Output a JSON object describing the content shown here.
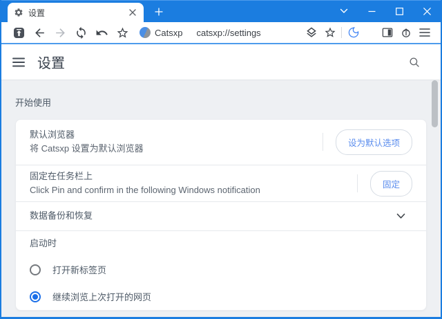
{
  "tabstrip": {
    "tab_title": "设置"
  },
  "window_controls": {
    "icons": [
      "chevron-down-icon",
      "minimize-icon",
      "maximize-icon",
      "close-icon"
    ]
  },
  "toolbar": {
    "site_label": "Catsxp",
    "url": "catsxp://settings",
    "left_icons": [
      "boss-key-icon",
      "back-icon",
      "forward-icon",
      "refresh-icon",
      "undo-icon",
      "star-icon"
    ],
    "right_icons": [
      "layers-icon",
      "bookmark-star-icon",
      "night-mode-moon-icon",
      "side-panel-icon",
      "update-icon",
      "menu-icon"
    ]
  },
  "page_header": {
    "title": "设置",
    "icons": [
      "hamburger-menu-icon",
      "search-icon"
    ]
  },
  "settings": {
    "sections": [
      {
        "label": "开始使用",
        "rows": [
          {
            "title": "默认浏览器",
            "subtitle": "将 Catsxp 设置为默认浏览器",
            "button": "设为默认选项"
          },
          {
            "title": "固定在任务栏上",
            "subtitle": "Click Pin and confirm in the following Windows notification",
            "button": "固定"
          },
          {
            "title": "数据备份和恢复",
            "expandable": true,
            "icon": "chevron-down-icon"
          }
        ]
      },
      {
        "label": "启动时",
        "radios": [
          {
            "label": "打开新标签页",
            "selected": false
          },
          {
            "label": "继续浏览上次打开的网页",
            "selected": true
          }
        ]
      }
    ]
  },
  "colors": {
    "titlebar_blue": "#1b7de0",
    "toolbar_accent_line": "#4e9cec",
    "page_bg": "#eef0f3",
    "card_bg": "#ffffff",
    "button_text_blue": "#5b8dee",
    "radio_selected_blue": "#1b6fe8",
    "text_primary": "#4e5a67",
    "text_secondary": "#5c6570",
    "moon_blue": "#4285f4"
  }
}
